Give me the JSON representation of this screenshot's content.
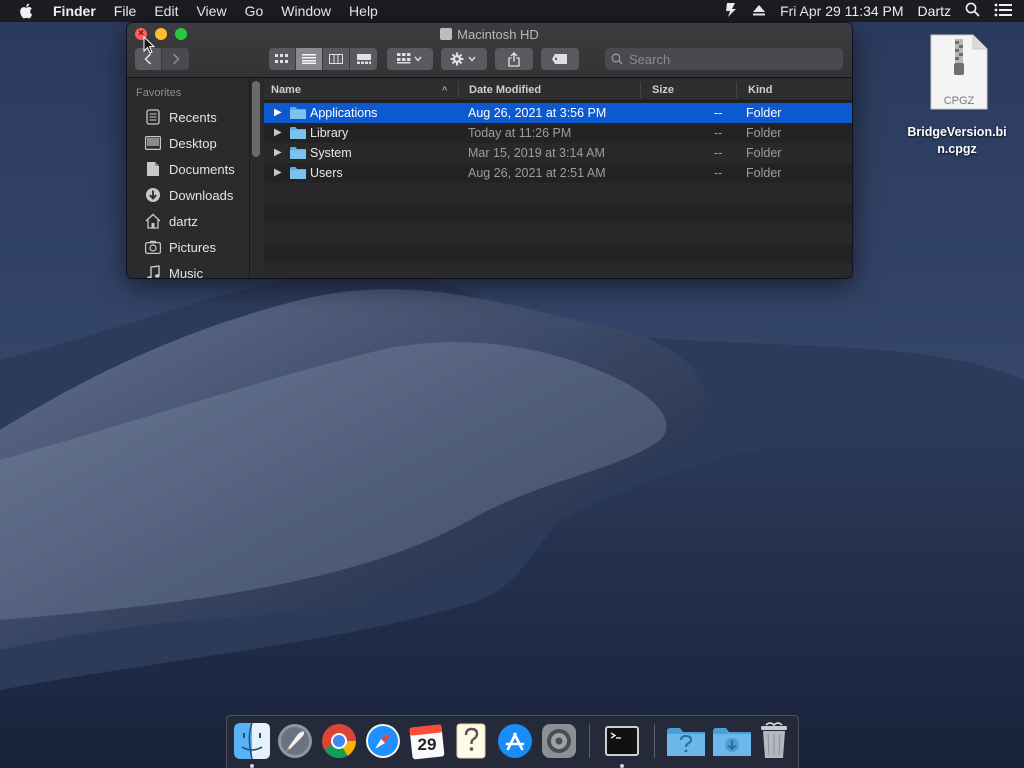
{
  "menubar": {
    "app_name": "Finder",
    "menus": [
      "File",
      "Edit",
      "View",
      "Go",
      "Window",
      "Help"
    ],
    "clock": "Fri Apr 29  11:34 PM",
    "user": "Dartz"
  },
  "window": {
    "title": "Macintosh HD",
    "search_placeholder": "Search",
    "sidebar": {
      "section": "Favorites",
      "items": [
        {
          "label": "Recents",
          "icon": "recents-icon"
        },
        {
          "label": "Desktop",
          "icon": "desktop-icon"
        },
        {
          "label": "Documents",
          "icon": "documents-icon"
        },
        {
          "label": "Downloads",
          "icon": "downloads-icon"
        },
        {
          "label": "dartz",
          "icon": "home-icon"
        },
        {
          "label": "Pictures",
          "icon": "pictures-icon"
        },
        {
          "label": "Music",
          "icon": "music-icon"
        }
      ]
    },
    "columns": [
      "Name",
      "Date Modified",
      "Size",
      "Kind"
    ],
    "rows": [
      {
        "name": "Applications",
        "date": "Aug 26, 2021 at 3:56 PM",
        "size": "--",
        "kind": "Folder",
        "selected": true
      },
      {
        "name": "Library",
        "date": "Today at 11:26 PM",
        "size": "--",
        "kind": "Folder"
      },
      {
        "name": "System",
        "date": "Mar 15, 2019 at 3:14 AM",
        "size": "--",
        "kind": "Folder"
      },
      {
        "name": "Users",
        "date": "Aug 26, 2021 at 2:51 AM",
        "size": "--",
        "kind": "Folder"
      }
    ]
  },
  "desktop_file": {
    "badge": "CPGZ",
    "name_line1": "BridgeVersion.bi",
    "name_line2": "n.cpgz"
  },
  "dock": {
    "apps": [
      "Finder",
      "Launchpad",
      "Google Chrome",
      "Safari",
      "Calendar",
      "Help Viewer",
      "App Store",
      "System Preferences",
      "Terminal",
      "Help Folder",
      "Downloads Folder",
      "Trash"
    ],
    "calendar_day": "29",
    "calendar_month": "APR"
  },
  "colors": {
    "selection": "#0c59d0",
    "folder": "#5fb0e6",
    "close": "#fe5f57",
    "minimize": "#febc2e",
    "zoom": "#28c840"
  }
}
